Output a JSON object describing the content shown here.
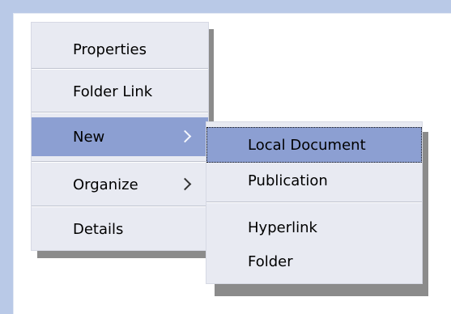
{
  "main_menu": {
    "items": [
      {
        "label": "Properties"
      },
      {
        "label": "Folder Link"
      },
      {
        "label": "New"
      },
      {
        "label": "Organize"
      },
      {
        "label": "Details"
      }
    ]
  },
  "submenu": {
    "items": [
      {
        "label": "Local Document"
      },
      {
        "label": "Publication"
      },
      {
        "label": "Hyperlink"
      },
      {
        "label": "Folder"
      }
    ]
  },
  "colors": {
    "background": "#b9c9e7",
    "menu_bg": "#e8eaf2",
    "highlight": "#8c9fd2",
    "shadow": "#8b8b8b"
  },
  "icons": {
    "submenu_arrow": "chevron-right-icon"
  }
}
